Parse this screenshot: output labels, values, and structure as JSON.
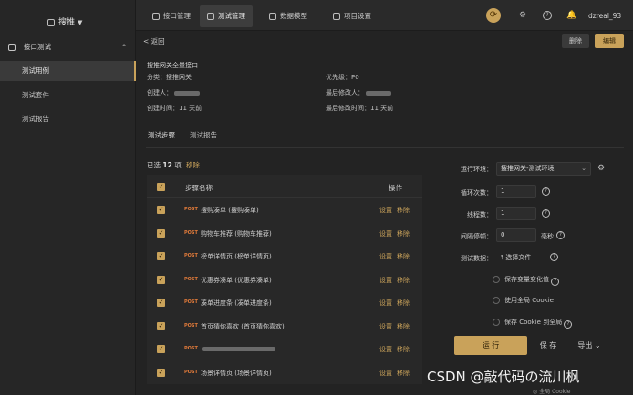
{
  "sidebar": {
    "project": "搜推",
    "group": "接口测试",
    "items": [
      "测试用例",
      "测试套件",
      "测试报告"
    ]
  },
  "topbar": {
    "tabs": [
      "接口管理",
      "测试管理",
      "数据模型",
      "项目设置"
    ],
    "active_tab": 1,
    "user": "dzreal_93"
  },
  "main": {
    "back": "< 返回",
    "delete_btn": "删除",
    "edit_btn": "编辑",
    "title": "搜推网关全量接口",
    "category": "分类：搜推网关",
    "priority": "优先级：P0",
    "creator": "创建人：",
    "last_editor": "最后修改人：",
    "created_time": "创建时间：11 天前",
    "modified_time": "最后修改时间：11 天前",
    "subtabs": [
      "测试步骤",
      "测试报告"
    ],
    "selected_prefix": "已选",
    "selected_count": "12",
    "selected_suffix": "项",
    "remove_selected": "移除"
  },
  "steps": {
    "head_name": "步骤名称",
    "head_op": "操作",
    "set_label": "设置",
    "remove_label": "移除",
    "rows": [
      {
        "method": "POST",
        "name": "搜购凑单 (搜购凑单)"
      },
      {
        "method": "POST",
        "name": "购物车推荐 (购物车推荐)"
      },
      {
        "method": "POST",
        "name": "榜单详情页 (榜单详情页)"
      },
      {
        "method": "POST",
        "name": "优惠券凑单 (优惠券凑单)"
      },
      {
        "method": "POST",
        "name": "凑单进度条 (凑单进度条)"
      },
      {
        "method": "POST",
        "name": "首页猜你喜欢 (首页猜你喜欢)"
      },
      {
        "method": "POST",
        "name": ""
      },
      {
        "method": "POST",
        "name": "场景详情页 (场景详情页)"
      }
    ]
  },
  "run_panel": {
    "env_label": "运行环境：",
    "env_value": "搜推网关-测试环境",
    "loop_label": "循环次数：",
    "loop_value": "1",
    "threads_label": "线程数：",
    "threads_value": "1",
    "interval_label": "间隔停顿：",
    "interval_value": "0",
    "interval_unit": "毫秒",
    "data_label": "测试数据：",
    "data_btn": "选择文件",
    "opt_save_vars": "保存变量变化值",
    "opt_global_cookie": "使用全局 Cookie",
    "opt_save_cookie": "保存 Cookie 到全局",
    "run_btn": "运 行",
    "save_btn": "保 存",
    "export_btn": "导出"
  },
  "footer": {
    "text": "全局 Cookie"
  },
  "watermark": "CSDN @敲代码の流川枫"
}
